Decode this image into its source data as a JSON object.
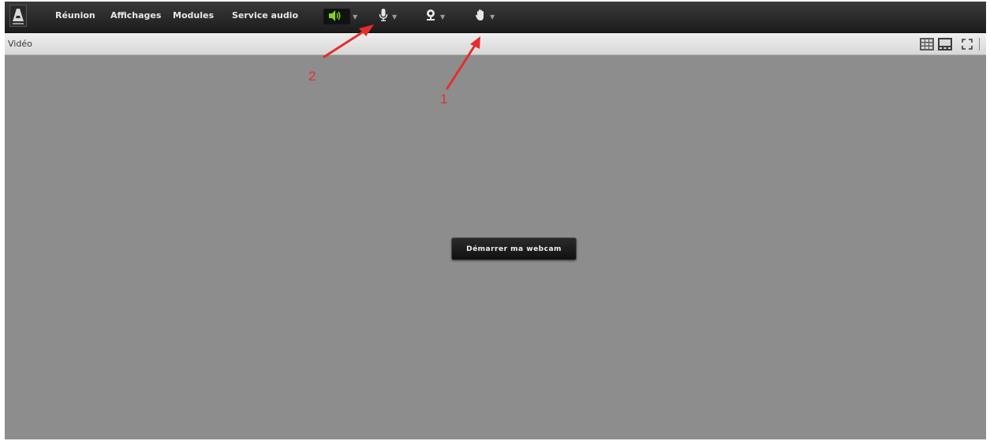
{
  "menubar": {
    "logo": "adobe-logo-icon",
    "items": [
      {
        "label": "Réunion"
      },
      {
        "label": "Affichages"
      },
      {
        "label": "Modules"
      },
      {
        "label": "Service audio"
      }
    ],
    "toolbar": [
      {
        "icon": "speaker-icon",
        "active_color": "#7ed321"
      },
      {
        "icon": "microphone-icon"
      },
      {
        "icon": "webcam-icon"
      },
      {
        "icon": "raise-hand-icon"
      }
    ]
  },
  "pod": {
    "title": "Vidéo",
    "view_icons": [
      "grid-view-icon",
      "filmstrip-view-icon",
      "fullscreen-icon"
    ]
  },
  "video": {
    "start_webcam_label": "Démarrer ma webcam"
  },
  "annotations": [
    {
      "label": "2"
    },
    {
      "label": "1"
    }
  ],
  "colors": {
    "annotation": "#e52d2d",
    "menubar": "#262626",
    "video_bg": "#8d8d8d"
  }
}
